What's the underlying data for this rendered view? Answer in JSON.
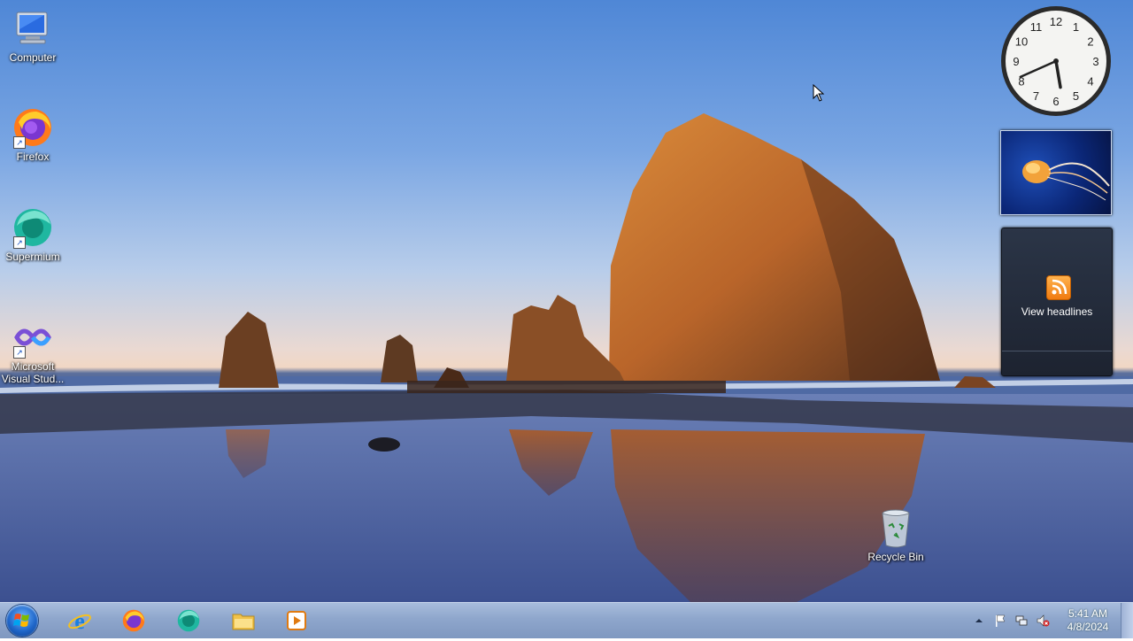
{
  "desktop": {
    "icons": [
      {
        "label": "Computer",
        "icon": "computer-icon",
        "shortcut": false
      },
      {
        "label": "Firefox",
        "icon": "firefox-icon",
        "shortcut": true
      },
      {
        "label": "Supermium",
        "icon": "supermium-icon",
        "shortcut": true
      },
      {
        "label": "Microsoft Visual Stud...",
        "icon": "visual-studio-icon",
        "shortcut": true
      },
      {
        "label": "Recycle Bin",
        "icon": "recycle-bin-icon",
        "shortcut": false
      }
    ]
  },
  "gadgets": {
    "clock": {
      "numbers": [
        "12",
        "1",
        "2",
        "3",
        "4",
        "5",
        "6",
        "7",
        "8",
        "9",
        "10",
        "11"
      ],
      "time": "5:41"
    },
    "slideshow": {
      "subject": "jellyfish"
    },
    "feed": {
      "label": "View headlines",
      "icon": "rss-icon"
    }
  },
  "taskbar": {
    "pinned": [
      {
        "name": "internet-explorer",
        "icon": "internet-explorer-icon"
      },
      {
        "name": "firefox",
        "icon": "firefox-icon"
      },
      {
        "name": "supermium",
        "icon": "supermium-icon"
      },
      {
        "name": "file-explorer",
        "icon": "folder-icon"
      },
      {
        "name": "media-player",
        "icon": "media-player-icon"
      }
    ],
    "tray": {
      "icons": [
        "chevron-up-icon",
        "flag-icon",
        "network-icon",
        "volume-muted-icon"
      ],
      "time": "5:41 AM",
      "date": "4/8/2024"
    }
  },
  "colors": {
    "taskbar": "#8ea6cc",
    "accent": "#1f66c9"
  }
}
